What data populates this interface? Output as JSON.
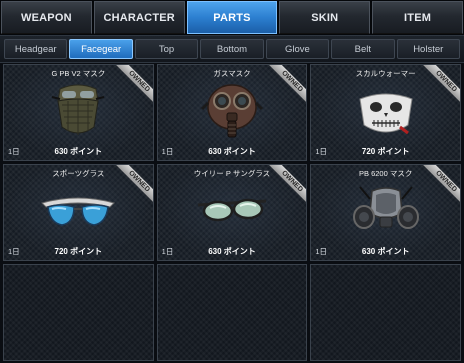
{
  "top_tabs": [
    {
      "label": "WEAPON",
      "active": false
    },
    {
      "label": "CHARACTER",
      "active": false
    },
    {
      "label": "PARTS",
      "active": true
    },
    {
      "label": "SKIN",
      "active": false
    },
    {
      "label": "ITEM",
      "active": false
    }
  ],
  "sub_tabs": [
    {
      "label": "Headgear",
      "active": false
    },
    {
      "label": "Facegear",
      "active": true
    },
    {
      "label": "Top",
      "active": false
    },
    {
      "label": "Bottom",
      "active": false
    },
    {
      "label": "Glove",
      "active": false
    },
    {
      "label": "Belt",
      "active": false
    },
    {
      "label": "Holster",
      "active": false
    }
  ],
  "items": [
    {
      "name": "G PB V2 マスク",
      "badge": "OWNED",
      "duration": "1日",
      "price": "630 ポイント",
      "icon": "tactical-mask-icon"
    },
    {
      "name": "ガスマスク",
      "badge": "OWNED",
      "duration": "1日",
      "price": "630 ポイント",
      "icon": "gas-mask-icon"
    },
    {
      "name": "スカルウォーマー",
      "badge": "OWNED",
      "duration": "1日",
      "price": "720 ポイント",
      "icon": "skull-mask-icon"
    },
    {
      "name": "スポーツグラス",
      "badge": "OWNED",
      "duration": "1日",
      "price": "720 ポイント",
      "icon": "sport-glasses-icon"
    },
    {
      "name": "ウイリー P サングラス",
      "badge": "OWNED",
      "duration": "1日",
      "price": "630 ポイント",
      "icon": "sunglasses-icon"
    },
    {
      "name": "PB 6200 マスク",
      "badge": "OWNED",
      "duration": "1日",
      "price": "630 ポイント",
      "icon": "respirator-icon"
    }
  ],
  "empty_slots": 3
}
